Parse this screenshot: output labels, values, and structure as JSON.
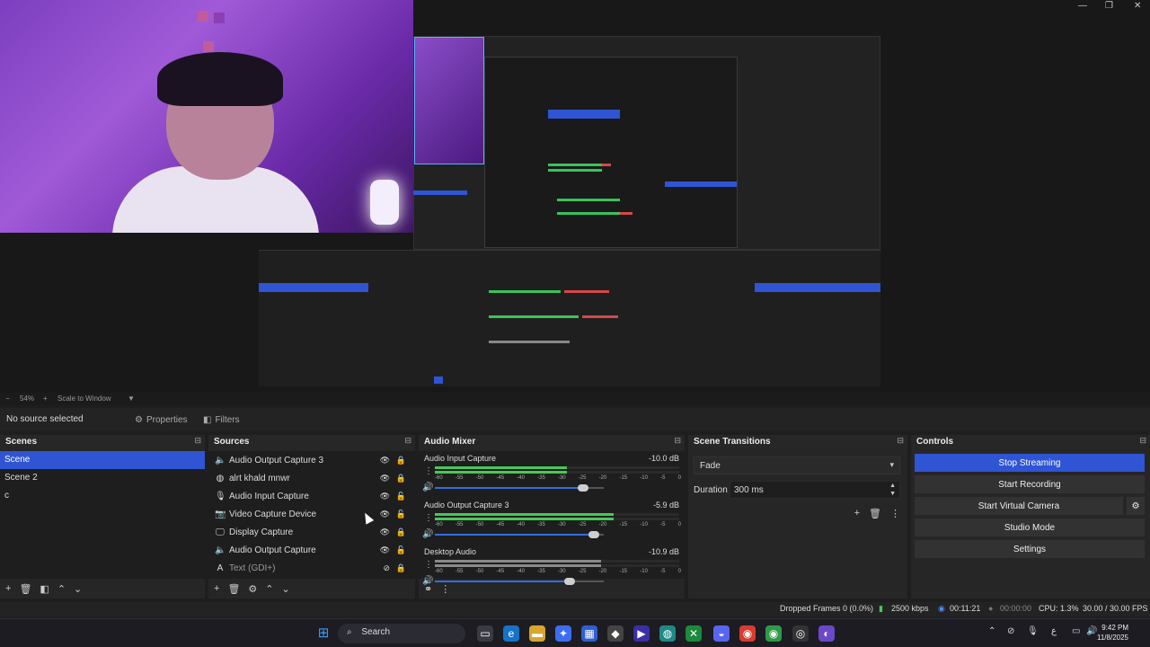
{
  "preview": {
    "zoom": "54%",
    "scale_mode": "Scale to Window"
  },
  "source_toolbar": {
    "no_source": "No source selected",
    "properties": "Properties",
    "filters": "Filters"
  },
  "scenes": {
    "title": "Scenes",
    "items": [
      "Scene",
      "Scene 2",
      "c"
    ],
    "active_index": 0
  },
  "sources": {
    "title": "Sources",
    "items": [
      {
        "label": "Audio Output Capture 3",
        "icon": "speaker-icon"
      },
      {
        "label": "alrt khald mnwr",
        "icon": "browser-icon"
      },
      {
        "label": "Audio Input Capture",
        "icon": "microphone-icon"
      },
      {
        "label": "Video Capture Device",
        "icon": "camera-icon"
      },
      {
        "label": "Display Capture",
        "icon": "monitor-icon"
      },
      {
        "label": "Audio Output Capture",
        "icon": "speaker-icon"
      },
      {
        "label": "Text (GDI+)",
        "icon": "text-icon"
      }
    ]
  },
  "mixer": {
    "title": "Audio Mixer",
    "channels": [
      {
        "name": "Audio Input Capture",
        "db": "-10.0 dB",
        "level": 0.54,
        "volume": 0.88
      },
      {
        "name": "Audio Output Capture 3",
        "db": "-5.9 dB",
        "level": 0.73,
        "volume": 0.94
      },
      {
        "name": "Desktop Audio",
        "db": "-10.9 dB",
        "level": 0.68,
        "volume": 0.8
      }
    ],
    "ticks": [
      "-60",
      "-55",
      "-50",
      "-45",
      "-40",
      "-35",
      "-30",
      "-25",
      "-20",
      "-15",
      "-10",
      "-5",
      "0"
    ]
  },
  "transitions": {
    "title": "Scene Transitions",
    "selected": "Fade",
    "duration_label": "Duration",
    "duration_value": "300 ms"
  },
  "controls": {
    "title": "Controls",
    "stop_streaming": "Stop Streaming",
    "start_recording": "Start Recording",
    "start_virtual_camera": "Start Virtual Camera",
    "studio_mode": "Studio Mode",
    "settings": "Settings"
  },
  "status": {
    "dropped": "Dropped Frames 0 (0.0%)",
    "bitrate": "2500 kbps",
    "stream_time": "00:11:21",
    "rec_time": "00:00:00",
    "cpu": "CPU: 1.3%",
    "fps": "30.00 / 30.00 FPS"
  },
  "taskbar": {
    "search": "Search",
    "time": "9:42 PM",
    "date": "11/8/2025"
  },
  "colors": {
    "accent": "#2f55d4",
    "meter_green": "#48c95a",
    "meter_yellow": "#d7b43a",
    "meter_red": "#b2353b"
  }
}
